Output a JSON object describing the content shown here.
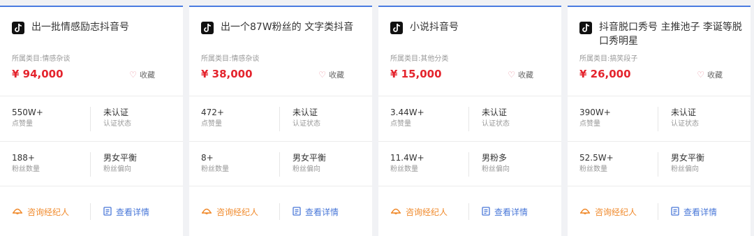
{
  "cards": [
    {
      "title": "出一批情感励志抖音号",
      "category": "所属类目:情感杂谈",
      "price": "¥ 94,000",
      "favorite": "收藏",
      "likes": {
        "value": "550W+",
        "label": "点赞量"
      },
      "verify": {
        "value": "未认证",
        "label": "认证状态"
      },
      "fans": {
        "value": "188+",
        "label": "粉丝数量"
      },
      "gender": {
        "value": "男女平衡",
        "label": "粉丝偏向"
      },
      "consult": "咨询经纪人",
      "detail": "查看详情"
    },
    {
      "title": "出一个87W粉丝的 文字类抖音",
      "category": "所属类目:情感杂谈",
      "price": "¥ 38,000",
      "favorite": "收藏",
      "likes": {
        "value": "472+",
        "label": "点赞量"
      },
      "verify": {
        "value": "未认证",
        "label": "认证状态"
      },
      "fans": {
        "value": "8+",
        "label": "粉丝数量"
      },
      "gender": {
        "value": "男女平衡",
        "label": "粉丝偏向"
      },
      "consult": "咨询经纪人",
      "detail": "查看详情"
    },
    {
      "title": "小说抖音号",
      "category": "所属类目:其他分类",
      "price": "¥ 15,000",
      "favorite": "收藏",
      "likes": {
        "value": "3.44W+",
        "label": "点赞量"
      },
      "verify": {
        "value": "未认证",
        "label": "认证状态"
      },
      "fans": {
        "value": "11.4W+",
        "label": "粉丝数量"
      },
      "gender": {
        "value": "男粉多",
        "label": "粉丝偏向"
      },
      "consult": "咨询经纪人",
      "detail": "查看详情"
    },
    {
      "title": "抖音脱口秀号 主推池子 李诞等脱口秀明星",
      "category": "所属类目:搞笑段子",
      "price": "¥ 26,000",
      "favorite": "收藏",
      "likes": {
        "value": "390W+",
        "label": "点赞量"
      },
      "verify": {
        "value": "未认证",
        "label": "认证状态"
      },
      "fans": {
        "value": "52.5W+",
        "label": "粉丝数量"
      },
      "gender": {
        "value": "男女平衡",
        "label": "粉丝偏向"
      },
      "consult": "咨询经纪人",
      "detail": "查看详情"
    }
  ],
  "icons": {
    "platform": "tiktok-logo-icon",
    "favorite": "heart-outline-icon",
    "consult": "agent-hat-icon",
    "detail": "document-icon"
  },
  "colors": {
    "accent_top": "#4a7be0",
    "price": "#e4242d",
    "consult": "#f08a2c",
    "detail": "#4a78d8"
  }
}
